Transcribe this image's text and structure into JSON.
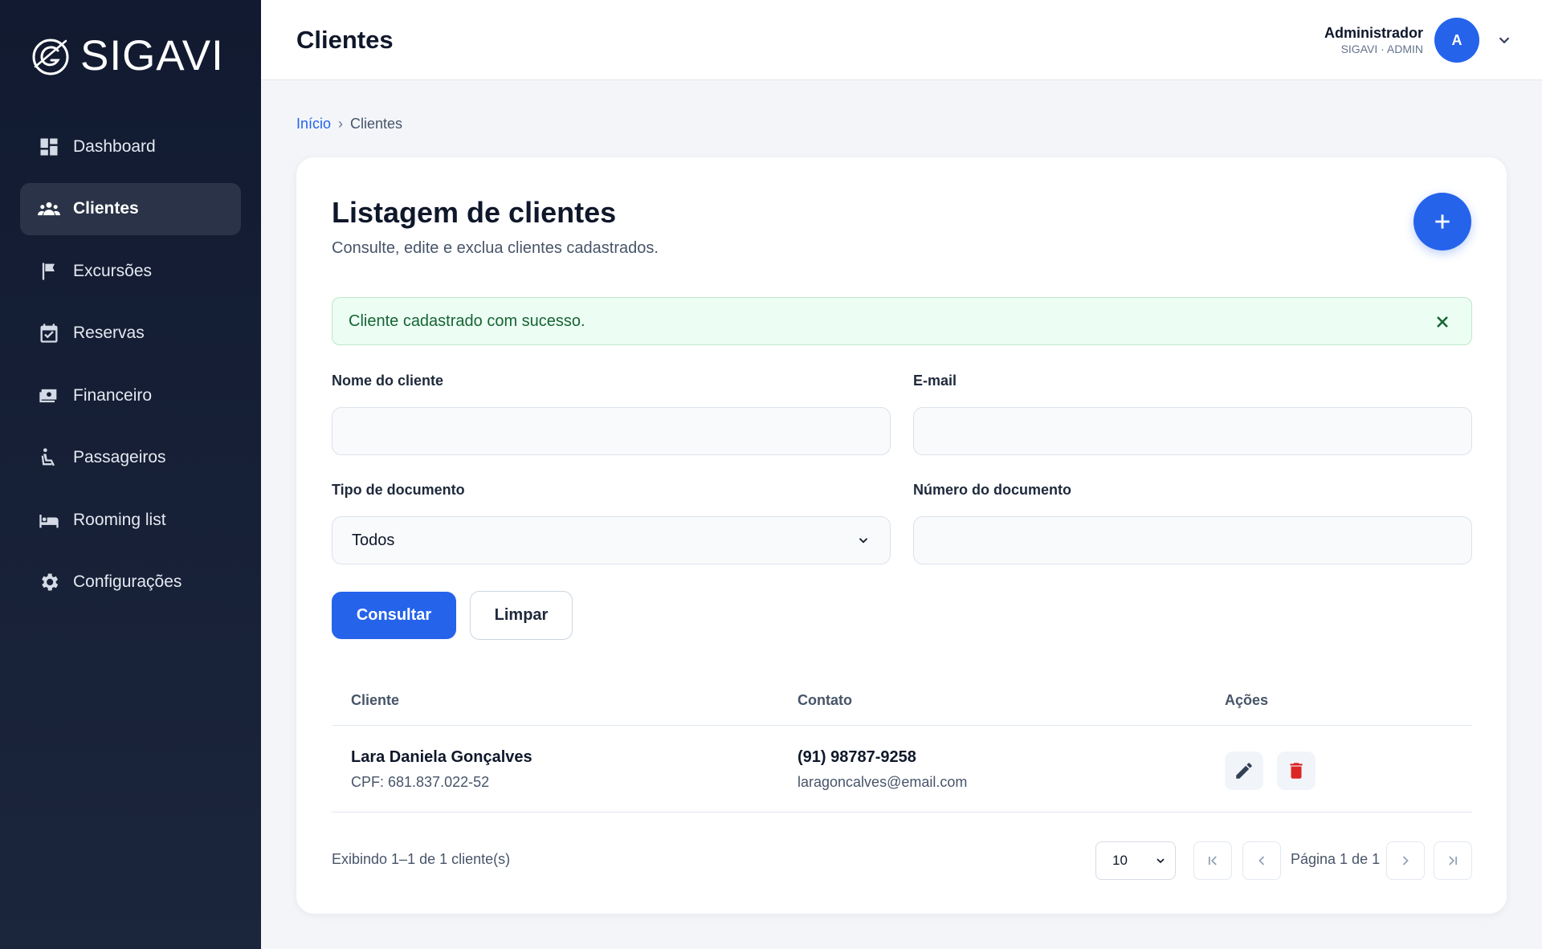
{
  "app": {
    "logo_text": "SIGAVI"
  },
  "sidebar": {
    "items": [
      {
        "label": "Dashboard",
        "icon": "dashboard-icon"
      },
      {
        "label": "Clientes",
        "icon": "users-icon",
        "active": true
      },
      {
        "label": "Excursões",
        "icon": "flag-icon"
      },
      {
        "label": "Reservas",
        "icon": "calendar-check-icon"
      },
      {
        "label": "Financeiro",
        "icon": "money-icon"
      },
      {
        "label": "Passageiros",
        "icon": "seat-icon"
      },
      {
        "label": "Rooming list",
        "icon": "bed-icon"
      },
      {
        "label": "Configurações",
        "icon": "gear-icon"
      }
    ]
  },
  "header": {
    "title": "Clientes",
    "user_name": "Administrador",
    "user_role": "SIGAVI · ADMIN",
    "avatar_initial": "A"
  },
  "breadcrumb": {
    "home": "Início",
    "separator": "›",
    "current": "Clientes"
  },
  "card": {
    "title": "Listagem de clientes",
    "subtitle": "Consulte, edite e exclua clientes cadastrados.",
    "alert": "Cliente cadastrado com sucesso."
  },
  "filters": {
    "name_label": "Nome do cliente",
    "name_value": "",
    "email_label": "E-mail",
    "email_value": "",
    "doc_type_label": "Tipo de documento",
    "doc_type_value": "Todos",
    "doc_number_label": "Número do documento",
    "doc_number_value": ""
  },
  "actions": {
    "search_label": "Consultar",
    "clear_label": "Limpar"
  },
  "table": {
    "columns": [
      "Cliente",
      "Contato",
      "Ações"
    ],
    "rows": [
      {
        "name": "Lara Daniela Gonçalves",
        "document": "CPF: 681.837.022-52",
        "phone": "(91) 98787-9258",
        "email": "laragoncalves@email.com"
      }
    ]
  },
  "pagination": {
    "info": "Exibindo 1–1 de 1 cliente(s)",
    "page_size": "10",
    "page_label": "Página 1 de 1"
  },
  "colors": {
    "sidebar_bg": "#111a30",
    "accent": "#2563eb",
    "success_bg": "#ecfdf3",
    "danger": "#dc2626"
  }
}
